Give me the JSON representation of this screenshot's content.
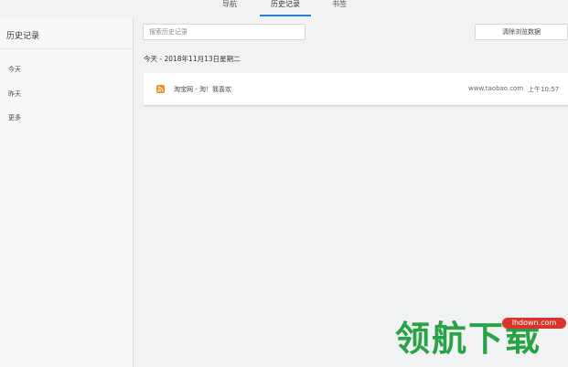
{
  "nav": {
    "tabs": [
      {
        "label": "导航",
        "active": false
      },
      {
        "label": "历史记录",
        "active": true
      },
      {
        "label": "书签",
        "active": false
      }
    ],
    "accent_color": "#2a7fd6"
  },
  "sidebar": {
    "title": "历史记录",
    "items": [
      {
        "label": "今天"
      },
      {
        "label": "昨天"
      },
      {
        "label": "更多"
      }
    ]
  },
  "search": {
    "placeholder": "搜索历史记录"
  },
  "toolbar": {
    "clear_label": "清除浏览数据"
  },
  "history": {
    "date_header": "今天 - 2018年11月13日星期二",
    "entries": [
      {
        "icon": "rss-icon",
        "title": "淘宝网 - 淘！我喜欢",
        "domain": "www.taobao.com",
        "time": "上午10:57"
      }
    ]
  },
  "watermark": {
    "text": "领航下载",
    "badge": "lhdown.com",
    "color": "#2aa246",
    "badge_color": "#d9342b"
  }
}
